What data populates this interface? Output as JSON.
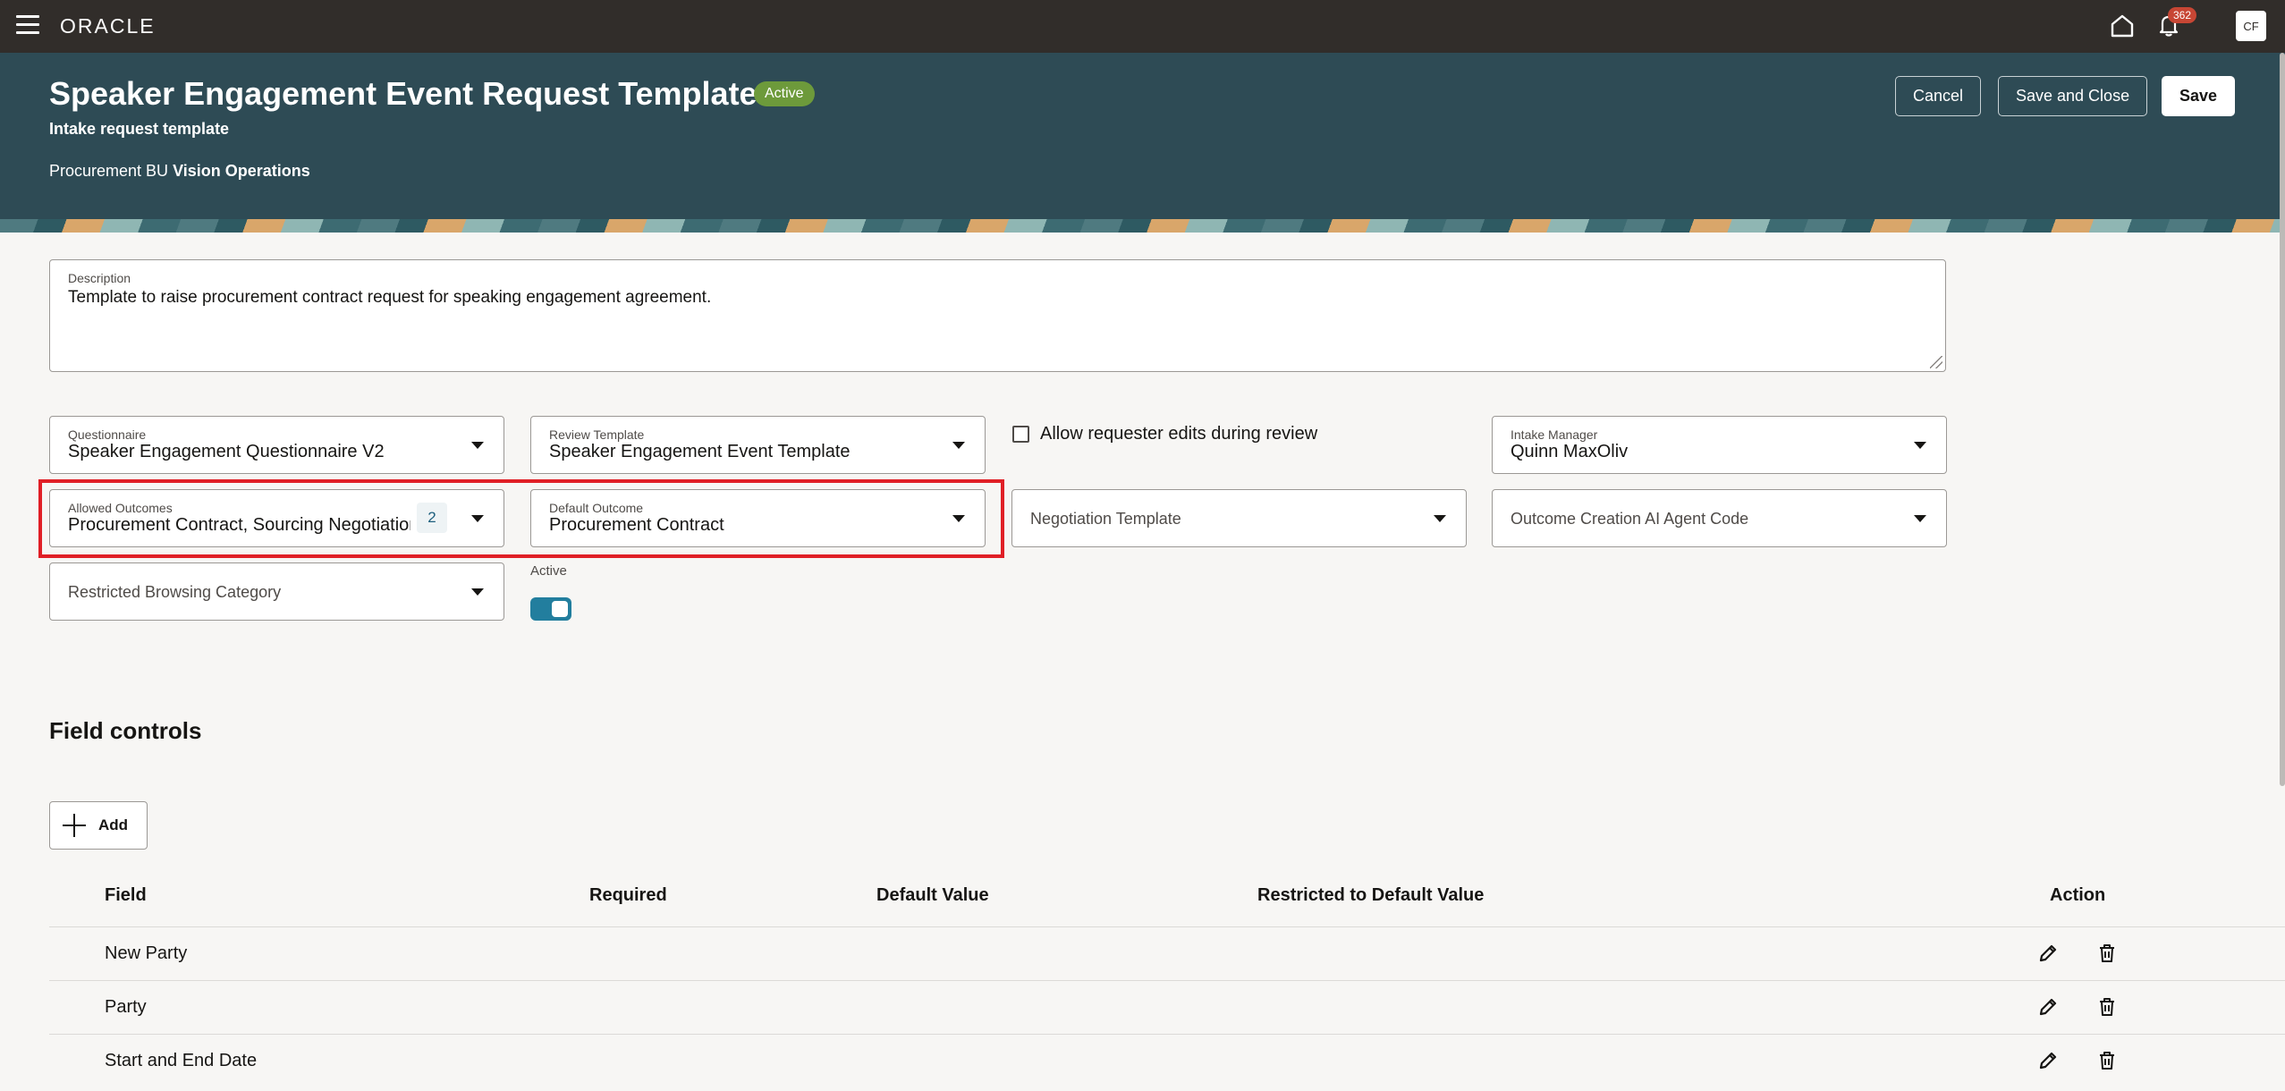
{
  "topbar": {
    "logo": "ORACLE",
    "notification_count": "362",
    "avatar_initials": "CF"
  },
  "header": {
    "title": "Speaker Engagement Event Request Template",
    "status": "Active",
    "subtitle": "Intake request template",
    "bu_label": "Procurement BU",
    "bu_value": "Vision Operations",
    "buttons": {
      "cancel": "Cancel",
      "save_close": "Save and Close",
      "save": "Save"
    }
  },
  "form": {
    "description": {
      "label": "Description",
      "value": "Template to raise procurement contract request for speaking engagement agreement."
    },
    "questionnaire": {
      "label": "Questionnaire",
      "value": "Speaker Engagement Questionnaire V2"
    },
    "review_template": {
      "label": "Review Template",
      "value": "Speaker Engagement Event Template"
    },
    "allow_edits": {
      "label": "Allow requester edits during review",
      "checked": false
    },
    "intake_manager": {
      "label": "Intake Manager",
      "value": "Quinn MaxOliv"
    },
    "allowed_outcomes": {
      "label": "Allowed Outcomes",
      "value": "Procurement Contract, Sourcing Negotiation",
      "count": "2"
    },
    "default_outcome": {
      "label": "Default Outcome",
      "value": "Procurement Contract"
    },
    "negotiation_template": {
      "placeholder": "Negotiation Template"
    },
    "outcome_ai_agent": {
      "placeholder": "Outcome Creation AI Agent Code"
    },
    "restricted_category": {
      "placeholder": "Restricted Browsing Category"
    },
    "active": {
      "label": "Active",
      "on": true
    }
  },
  "field_controls": {
    "title": "Field controls",
    "add_label": "Add",
    "columns": {
      "field": "Field",
      "required": "Required",
      "default_value": "Default Value",
      "restricted": "Restricted to Default Value",
      "action": "Action"
    },
    "rows": [
      {
        "field": "New Party"
      },
      {
        "field": "Party"
      },
      {
        "field": "Start and End Date"
      }
    ]
  },
  "colors": {
    "header_bg": "#2e4b55",
    "topbar_bg": "#312d2a",
    "active_badge": "#6d9a3b",
    "highlight": "#e01f26",
    "toggle_on": "#227e9e"
  }
}
